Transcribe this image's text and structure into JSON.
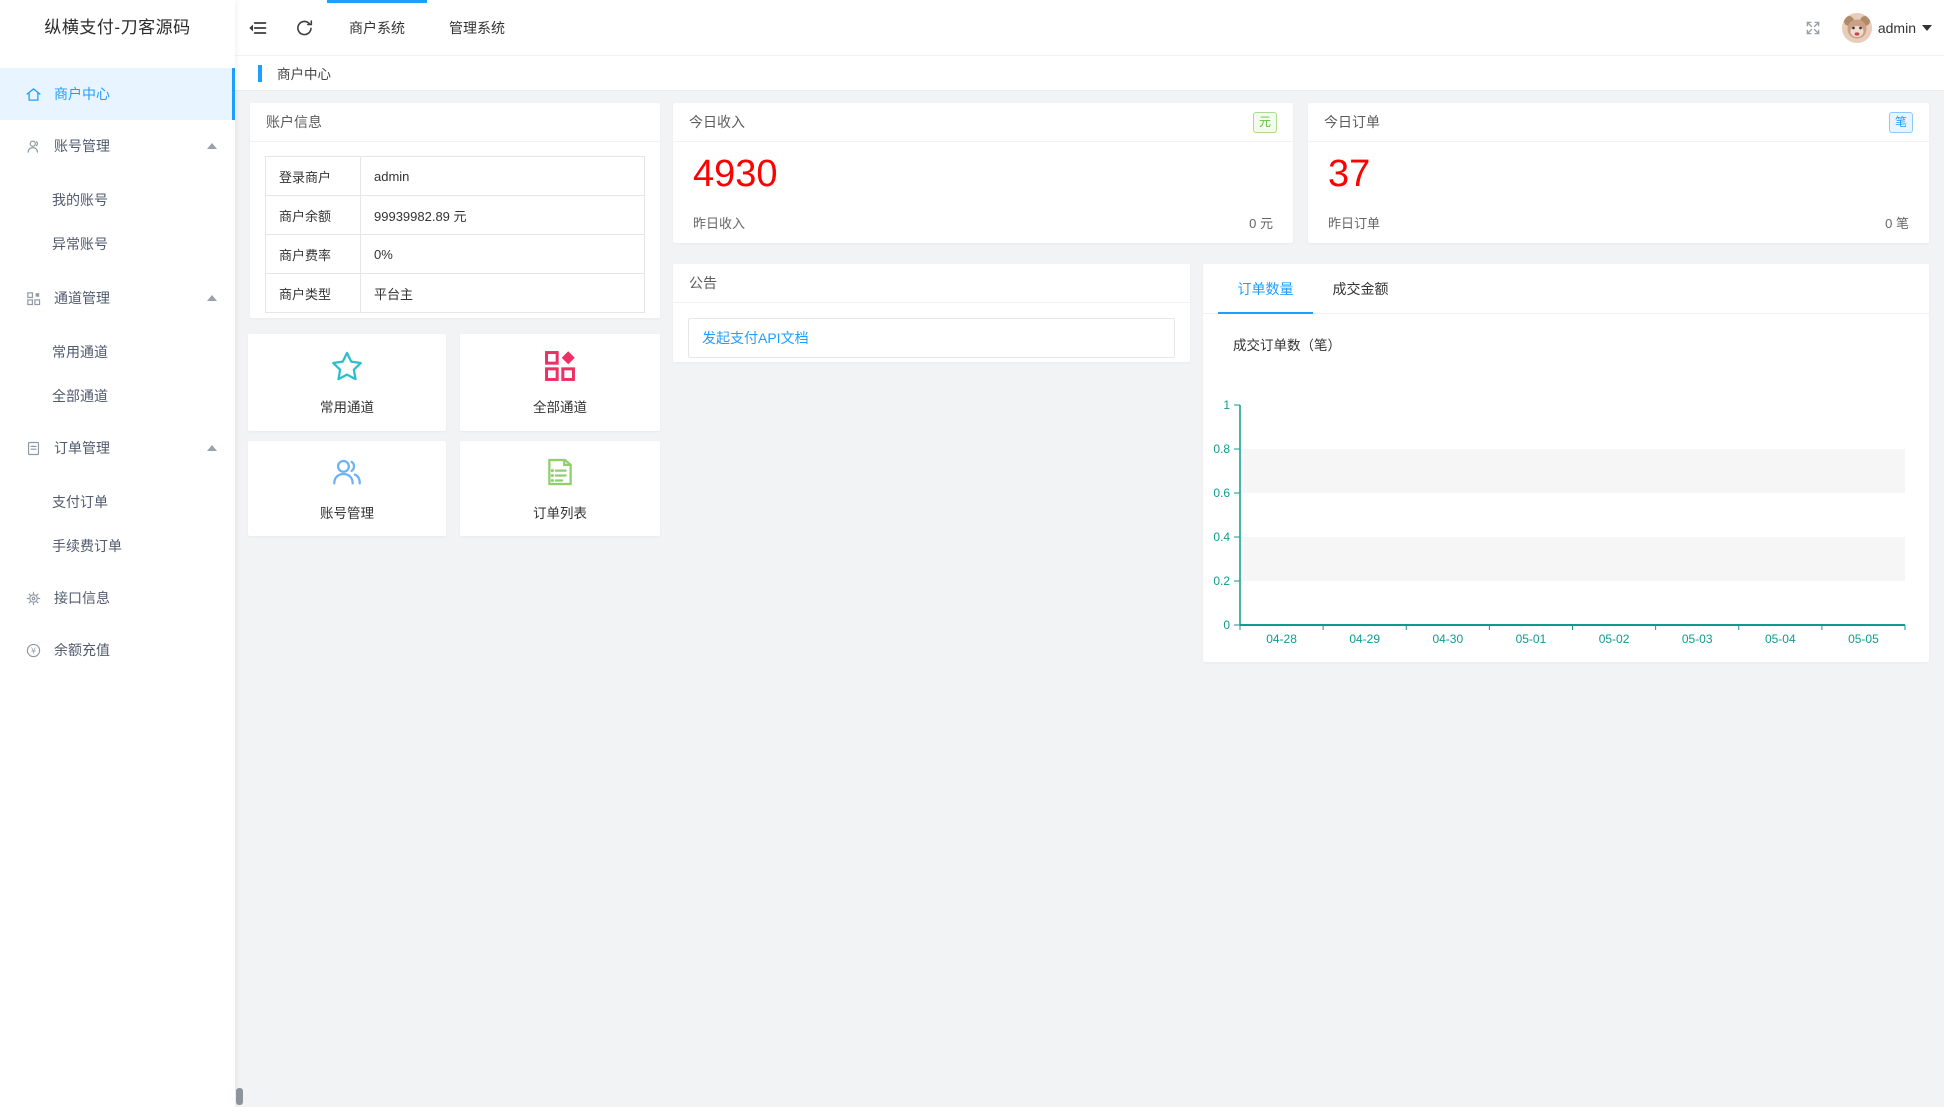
{
  "app": {
    "logo_title": "纵横支付-刀客源码"
  },
  "colors": {
    "primary": "#1e9fff",
    "value_red": "#ff0000",
    "chart_axis": "#0f9b8e",
    "badge_green": "#67c23a",
    "star_icon": "#2bbfca",
    "grid_icon": "#ee2f64",
    "users_icon": "#6cb2f5",
    "list_icon": "#8fd06a"
  },
  "header": {
    "tabs": [
      {
        "label": "商户系统",
        "active": true
      },
      {
        "label": "管理系统",
        "active": false
      }
    ],
    "user": {
      "name": "admin"
    }
  },
  "breadcrumb": {
    "title": "商户中心"
  },
  "sidebar": {
    "items": [
      {
        "type": "item",
        "icon": "home-icon",
        "label": "商户中心",
        "active": true
      },
      {
        "type": "group",
        "icon": "user-icon",
        "label": "账号管理",
        "expanded": true
      },
      {
        "type": "sub",
        "label": "我的账号"
      },
      {
        "type": "sub",
        "label": "异常账号"
      },
      {
        "type": "group",
        "icon": "grid-icon",
        "label": "通道管理",
        "expanded": true
      },
      {
        "type": "sub",
        "label": "常用通道"
      },
      {
        "type": "sub",
        "label": "全部通道"
      },
      {
        "type": "group",
        "icon": "doc-icon",
        "label": "订单管理",
        "expanded": true
      },
      {
        "type": "sub",
        "label": "支付订单"
      },
      {
        "type": "sub",
        "label": "手续费订单"
      },
      {
        "type": "item",
        "icon": "gear-icon",
        "label": "接口信息",
        "active": false
      },
      {
        "type": "item",
        "icon": "yen-icon",
        "label": "余额充值",
        "active": false
      }
    ]
  },
  "account_card": {
    "title": "账户信息",
    "rows": [
      {
        "label": "登录商户",
        "value": "admin"
      },
      {
        "label": "商户余额",
        "value": "99939982.89 元"
      },
      {
        "label": "商户费率",
        "value": "0%"
      },
      {
        "label": "商户类型",
        "value": "平台主"
      }
    ]
  },
  "shortcuts": [
    {
      "label": "常用通道",
      "icon": "star-icon"
    },
    {
      "label": "全部通道",
      "icon": "grid-icon"
    },
    {
      "label": "账号管理",
      "icon": "users-icon"
    },
    {
      "label": "订单列表",
      "icon": "list-icon"
    }
  ],
  "stats": [
    {
      "title": "今日收入",
      "badge": "元",
      "value": "4930",
      "footer_label": "昨日收入",
      "footer_value": "0 元"
    },
    {
      "title": "今日订单",
      "badge": "笔",
      "value": "37",
      "footer_label": "昨日订单",
      "footer_value": "0 笔"
    }
  ],
  "notice_card": {
    "title": "公告",
    "link": "发起支付API文档"
  },
  "chart_card": {
    "tabs": [
      {
        "label": "订单数量",
        "active": true
      },
      {
        "label": "成交金额",
        "active": false
      }
    ]
  },
  "chart_data": {
    "type": "line",
    "title": "成交订单数（笔）",
    "categories": [
      "04-28",
      "04-29",
      "04-30",
      "05-01",
      "05-02",
      "05-03",
      "05-04",
      "05-05"
    ],
    "series": [
      {
        "name": "订单数量",
        "values": [
          0,
          0,
          0,
          0,
          0,
          0,
          0,
          0
        ]
      }
    ],
    "xlabel": "",
    "ylabel": "",
    "ylim": [
      0,
      1
    ],
    "yticks": [
      0,
      0.2,
      0.4,
      0.6,
      0.8,
      1
    ],
    "grid": "alternating-bands",
    "legend": "none",
    "axis_color": "#0f9b8e",
    "band_color": "#f6f6f6"
  }
}
